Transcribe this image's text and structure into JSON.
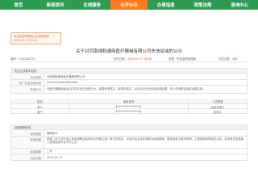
{
  "nav": {
    "items": [
      "首页",
      "新闻资讯",
      "在线服务",
      "公开公示",
      "办事指南",
      "政策法规",
      "查询中心"
    ],
    "active_index": 3
  },
  "badge": {
    "line1": "本文包含网签前公示信息相关",
    "line2": "2019-07-17 09:10"
  },
  "page_title": "关于对河南禄和通商医疗器械有限公司失信惩戒的公示",
  "infobar": {
    "number_label": "编号：",
    "number_value": "24QZ48723",
    "date_label": "发布日期：",
    "date_value": "2019-07-17 09:10",
    "source_label": "来源：",
    "source_value": "市场监督管理局",
    "views_label": "浏览次数：",
    "views_value": "188"
  },
  "section_subject": {
    "title": "失信主体基本信息",
    "rows": [
      {
        "label": "企业名称",
        "value": "河南禄和通商医疗器械有限公司"
      },
      {
        "label": "统一社会信用代码",
        "value": "91410100MA46B1XD5"
      },
      {
        "label": "失信行为",
        "value": "在医疗器械经营活动中存在违法违规行为，依据有关规定，经调查核实，对该企业作出失信惩戒处理，列入失信联合惩戒对象名单。"
      }
    ]
  },
  "persons_table": {
    "headers": [
      "姓名",
      "身份证号",
      "人员类型"
    ],
    "rows": [
      [
        "李**",
        "41**************12",
        "法定代表人"
      ],
      [
        "张**",
        "41**************34",
        "负责人"
      ]
    ]
  },
  "section_decision": {
    "title": "惩戒措施信息",
    "rows": [
      {
        "label": "惩戒措施",
        "value": "限制参与"
      },
      {
        "label": "惩戒依据",
        "value": "根据《关于对失信主体实施联合惩戒的合作备忘录》等文件规定，对该失信主体实施联合惩戒措施，限制其参与政府采购、工程招投标等相关活动，并将有关信息纳入信用信息平台予以公示。"
      },
      {
        "label": "惩戒期限",
        "value": "三年"
      },
      {
        "label": "决定日期",
        "value": "2019-07-17"
      }
    ]
  },
  "colors": {
    "nav_background": "#2f9a52",
    "nav_active": "#ff7a1f",
    "accent_red": "#e0401f"
  }
}
